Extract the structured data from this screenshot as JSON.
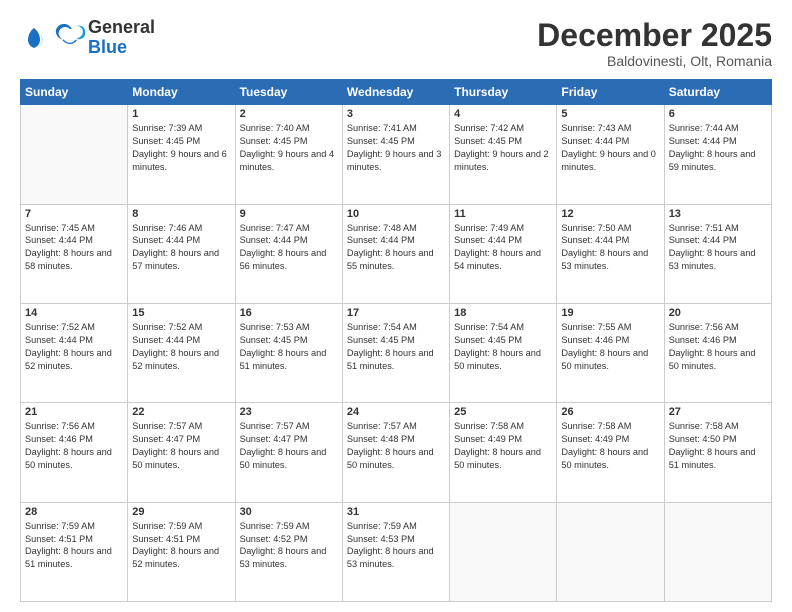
{
  "logo": {
    "general": "General",
    "blue": "Blue"
  },
  "title": "December 2025",
  "location": "Baldovinesti, Olt, Romania",
  "days_of_week": [
    "Sunday",
    "Monday",
    "Tuesday",
    "Wednesday",
    "Thursday",
    "Friday",
    "Saturday"
  ],
  "weeks": [
    [
      {
        "day": "",
        "sunrise": "",
        "sunset": "",
        "daylight": ""
      },
      {
        "day": "1",
        "sunrise": "Sunrise: 7:39 AM",
        "sunset": "Sunset: 4:45 PM",
        "daylight": "Daylight: 9 hours and 6 minutes."
      },
      {
        "day": "2",
        "sunrise": "Sunrise: 7:40 AM",
        "sunset": "Sunset: 4:45 PM",
        "daylight": "Daylight: 9 hours and 4 minutes."
      },
      {
        "day": "3",
        "sunrise": "Sunrise: 7:41 AM",
        "sunset": "Sunset: 4:45 PM",
        "daylight": "Daylight: 9 hours and 3 minutes."
      },
      {
        "day": "4",
        "sunrise": "Sunrise: 7:42 AM",
        "sunset": "Sunset: 4:45 PM",
        "daylight": "Daylight: 9 hours and 2 minutes."
      },
      {
        "day": "5",
        "sunrise": "Sunrise: 7:43 AM",
        "sunset": "Sunset: 4:44 PM",
        "daylight": "Daylight: 9 hours and 0 minutes."
      },
      {
        "day": "6",
        "sunrise": "Sunrise: 7:44 AM",
        "sunset": "Sunset: 4:44 PM",
        "daylight": "Daylight: 8 hours and 59 minutes."
      }
    ],
    [
      {
        "day": "7",
        "sunrise": "Sunrise: 7:45 AM",
        "sunset": "Sunset: 4:44 PM",
        "daylight": "Daylight: 8 hours and 58 minutes."
      },
      {
        "day": "8",
        "sunrise": "Sunrise: 7:46 AM",
        "sunset": "Sunset: 4:44 PM",
        "daylight": "Daylight: 8 hours and 57 minutes."
      },
      {
        "day": "9",
        "sunrise": "Sunrise: 7:47 AM",
        "sunset": "Sunset: 4:44 PM",
        "daylight": "Daylight: 8 hours and 56 minutes."
      },
      {
        "day": "10",
        "sunrise": "Sunrise: 7:48 AM",
        "sunset": "Sunset: 4:44 PM",
        "daylight": "Daylight: 8 hours and 55 minutes."
      },
      {
        "day": "11",
        "sunrise": "Sunrise: 7:49 AM",
        "sunset": "Sunset: 4:44 PM",
        "daylight": "Daylight: 8 hours and 54 minutes."
      },
      {
        "day": "12",
        "sunrise": "Sunrise: 7:50 AM",
        "sunset": "Sunset: 4:44 PM",
        "daylight": "Daylight: 8 hours and 53 minutes."
      },
      {
        "day": "13",
        "sunrise": "Sunrise: 7:51 AM",
        "sunset": "Sunset: 4:44 PM",
        "daylight": "Daylight: 8 hours and 53 minutes."
      }
    ],
    [
      {
        "day": "14",
        "sunrise": "Sunrise: 7:52 AM",
        "sunset": "Sunset: 4:44 PM",
        "daylight": "Daylight: 8 hours and 52 minutes."
      },
      {
        "day": "15",
        "sunrise": "Sunrise: 7:52 AM",
        "sunset": "Sunset: 4:44 PM",
        "daylight": "Daylight: 8 hours and 52 minutes."
      },
      {
        "day": "16",
        "sunrise": "Sunrise: 7:53 AM",
        "sunset": "Sunset: 4:45 PM",
        "daylight": "Daylight: 8 hours and 51 minutes."
      },
      {
        "day": "17",
        "sunrise": "Sunrise: 7:54 AM",
        "sunset": "Sunset: 4:45 PM",
        "daylight": "Daylight: 8 hours and 51 minutes."
      },
      {
        "day": "18",
        "sunrise": "Sunrise: 7:54 AM",
        "sunset": "Sunset: 4:45 PM",
        "daylight": "Daylight: 8 hours and 50 minutes."
      },
      {
        "day": "19",
        "sunrise": "Sunrise: 7:55 AM",
        "sunset": "Sunset: 4:46 PM",
        "daylight": "Daylight: 8 hours and 50 minutes."
      },
      {
        "day": "20",
        "sunrise": "Sunrise: 7:56 AM",
        "sunset": "Sunset: 4:46 PM",
        "daylight": "Daylight: 8 hours and 50 minutes."
      }
    ],
    [
      {
        "day": "21",
        "sunrise": "Sunrise: 7:56 AM",
        "sunset": "Sunset: 4:46 PM",
        "daylight": "Daylight: 8 hours and 50 minutes."
      },
      {
        "day": "22",
        "sunrise": "Sunrise: 7:57 AM",
        "sunset": "Sunset: 4:47 PM",
        "daylight": "Daylight: 8 hours and 50 minutes."
      },
      {
        "day": "23",
        "sunrise": "Sunrise: 7:57 AM",
        "sunset": "Sunset: 4:47 PM",
        "daylight": "Daylight: 8 hours and 50 minutes."
      },
      {
        "day": "24",
        "sunrise": "Sunrise: 7:57 AM",
        "sunset": "Sunset: 4:48 PM",
        "daylight": "Daylight: 8 hours and 50 minutes."
      },
      {
        "day": "25",
        "sunrise": "Sunrise: 7:58 AM",
        "sunset": "Sunset: 4:49 PM",
        "daylight": "Daylight: 8 hours and 50 minutes."
      },
      {
        "day": "26",
        "sunrise": "Sunrise: 7:58 AM",
        "sunset": "Sunset: 4:49 PM",
        "daylight": "Daylight: 8 hours and 50 minutes."
      },
      {
        "day": "27",
        "sunrise": "Sunrise: 7:58 AM",
        "sunset": "Sunset: 4:50 PM",
        "daylight": "Daylight: 8 hours and 51 minutes."
      }
    ],
    [
      {
        "day": "28",
        "sunrise": "Sunrise: 7:59 AM",
        "sunset": "Sunset: 4:51 PM",
        "daylight": "Daylight: 8 hours and 51 minutes."
      },
      {
        "day": "29",
        "sunrise": "Sunrise: 7:59 AM",
        "sunset": "Sunset: 4:51 PM",
        "daylight": "Daylight: 8 hours and 52 minutes."
      },
      {
        "day": "30",
        "sunrise": "Sunrise: 7:59 AM",
        "sunset": "Sunset: 4:52 PM",
        "daylight": "Daylight: 8 hours and 53 minutes."
      },
      {
        "day": "31",
        "sunrise": "Sunrise: 7:59 AM",
        "sunset": "Sunset: 4:53 PM",
        "daylight": "Daylight: 8 hours and 53 minutes."
      },
      {
        "day": "",
        "sunrise": "",
        "sunset": "",
        "daylight": ""
      },
      {
        "day": "",
        "sunrise": "",
        "sunset": "",
        "daylight": ""
      },
      {
        "day": "",
        "sunrise": "",
        "sunset": "",
        "daylight": ""
      }
    ]
  ]
}
